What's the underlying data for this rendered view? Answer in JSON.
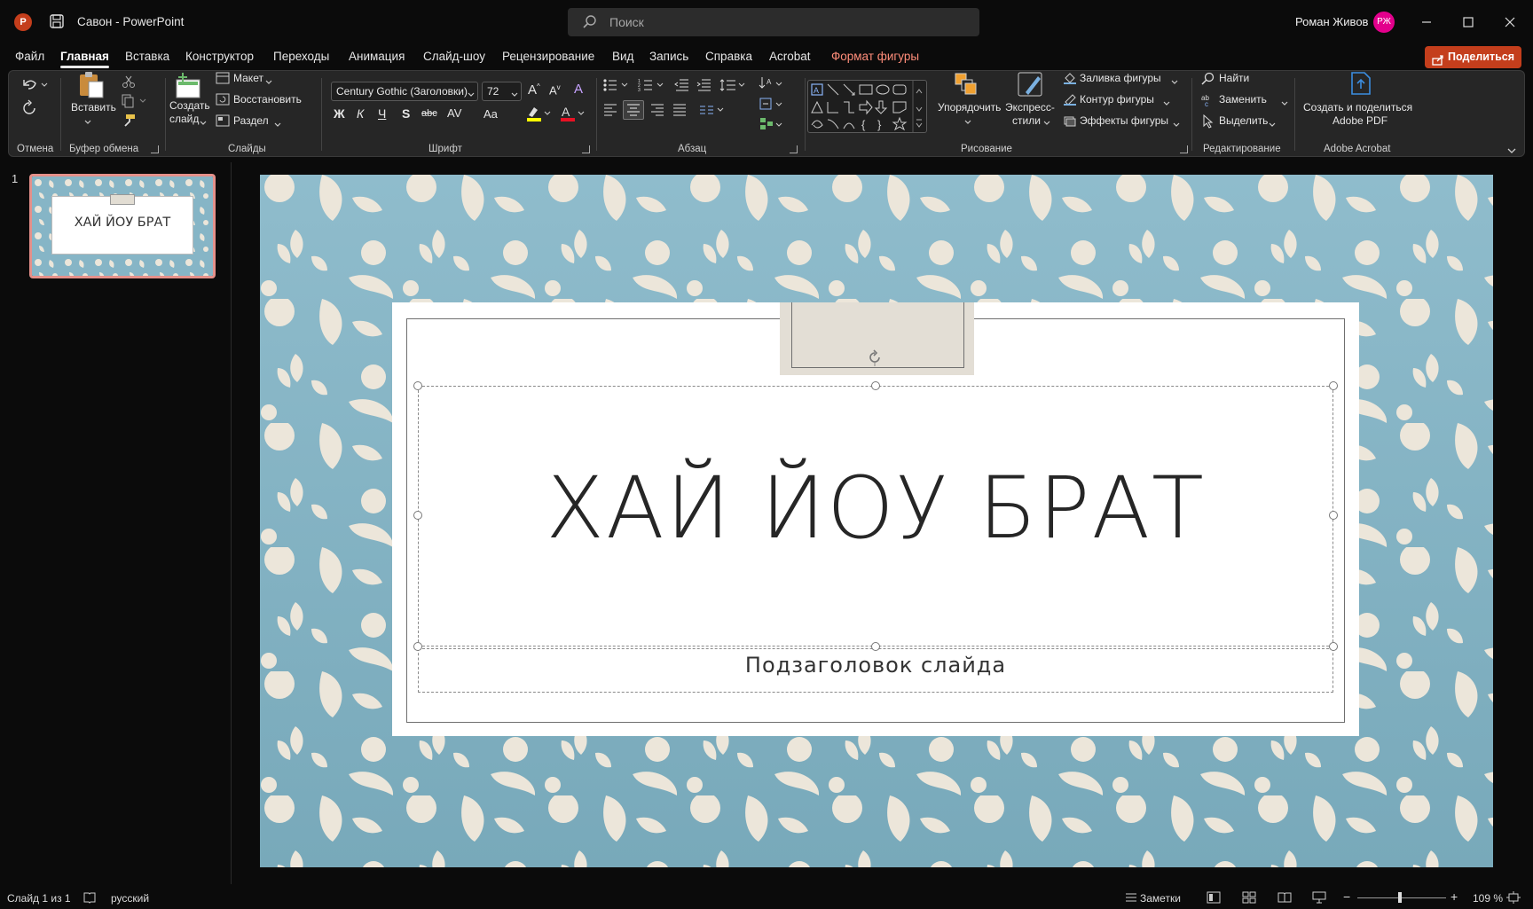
{
  "app": {
    "title": "Савон  -  PowerPoint",
    "app_icon_letter": "P",
    "search_placeholder": "Поиск",
    "user_name": "Роман Живов",
    "user_initials": "РЖ"
  },
  "tabs": [
    "Файл",
    "Главная",
    "Вставка",
    "Конструктор",
    "Переходы",
    "Анимация",
    "Слайд-шоу",
    "Рецензирование",
    "Вид",
    "Запись",
    "Справка",
    "Acrobat",
    "Формат фигуры"
  ],
  "share_label": "Поделиться",
  "ribbon": {
    "groups": {
      "undo": "Отмена",
      "clipboard": "Буфер обмена",
      "slides": "Слайды",
      "font": "Шрифт",
      "paragraph": "Абзац",
      "drawing": "Рисование",
      "editing": "Редактирование",
      "acrobat": "Adobe Acrobat"
    },
    "paste": "Вставить",
    "new_slide_line1": "Создать",
    "new_slide_line2": "слайд",
    "layout": "Макет",
    "reset": "Восстановить",
    "section": "Раздел",
    "font_name": "Century Gothic (Заголовки)",
    "font_size": "72",
    "bold": "Ж",
    "italic": "К",
    "underline": "Ч",
    "shadow": "S",
    "strike": "abc",
    "spacing": "AV",
    "case": "Aa",
    "arrange": "Упорядочить",
    "quick_styles_line1": "Экспресс-",
    "quick_styles_line2": "стили",
    "shape_fill": "Заливка фигуры",
    "shape_outline": "Контур фигуры",
    "shape_effects": "Эффекты фигуры",
    "find": "Найти",
    "replace": "Заменить",
    "select": "Выделить",
    "acrobat_line1": "Создать и поделиться",
    "acrobat_line2": "Adobe PDF"
  },
  "thumbnails": [
    {
      "number": "1",
      "title": "ХАЙ ЙОУ БРАТ"
    }
  ],
  "slide": {
    "title": "ХАЙ ЙОУ БРАТ",
    "subtitle": "Подзаголовок слайда"
  },
  "status": {
    "slide_info": "Слайд 1 из 1",
    "language": "русский",
    "notes": "Заметки",
    "zoom": "109 %"
  },
  "colors": {
    "accent": "#c43e1c",
    "slide_bg": "#8fbccc",
    "pattern": "#ece6da",
    "thumb_selected": "#e4908a",
    "contextual_tab": "#ff8d7a"
  }
}
